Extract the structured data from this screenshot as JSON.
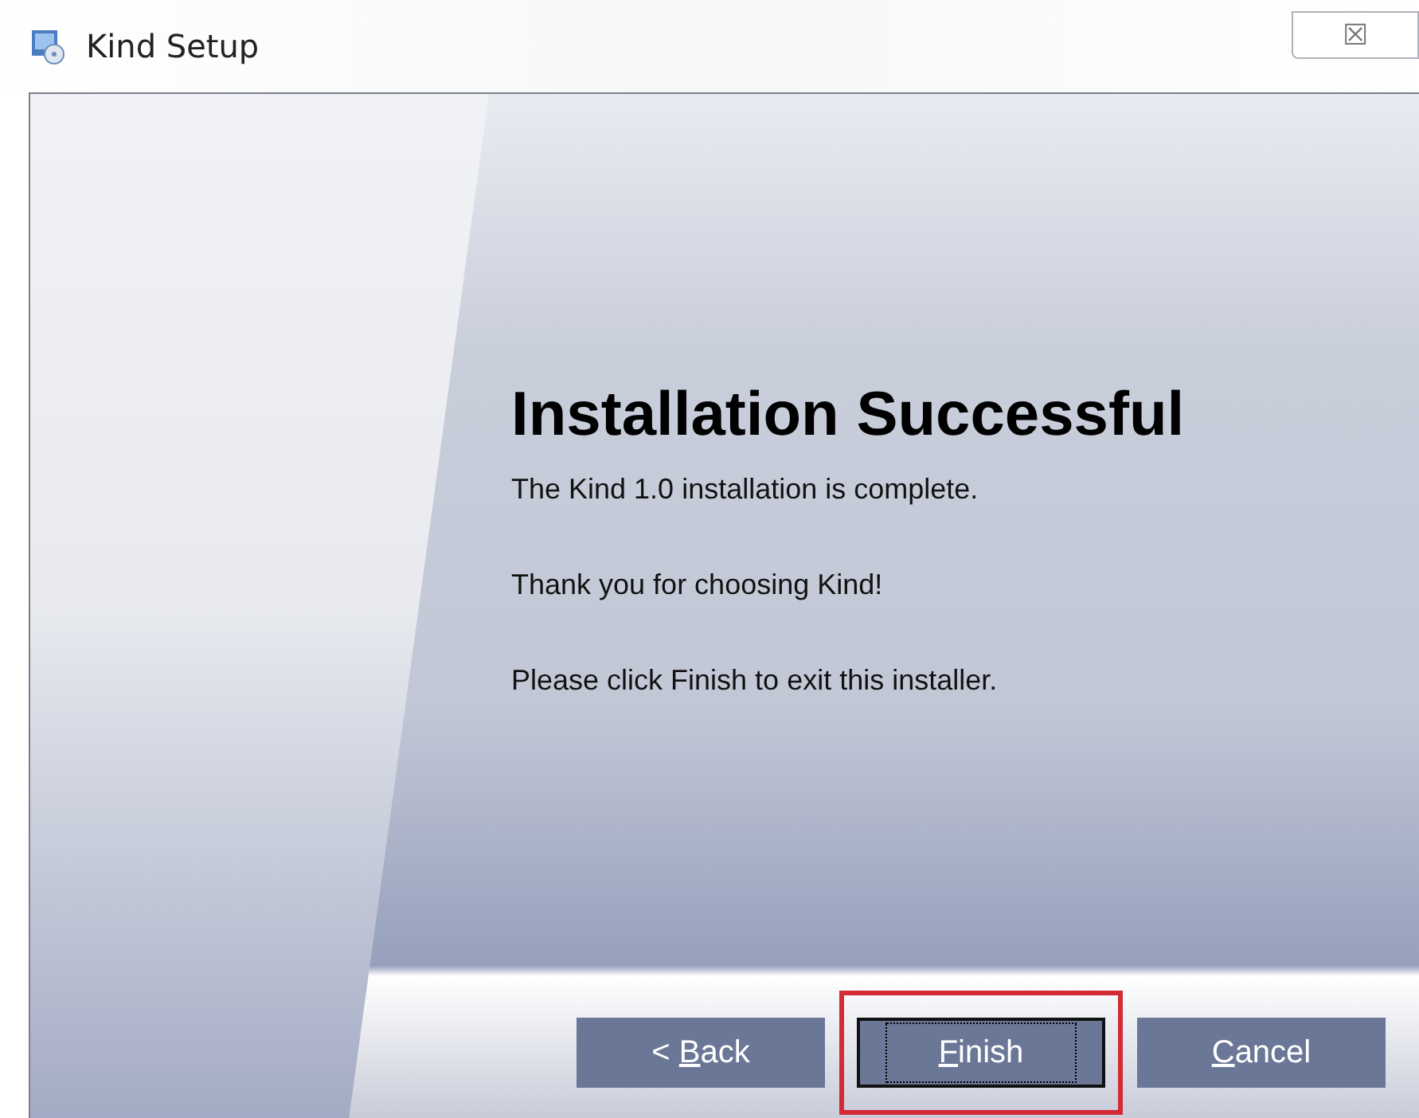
{
  "window": {
    "title": "Kind Setup",
    "close_symbol": "☒"
  },
  "content": {
    "heading": "Installation Successful",
    "paragraphs": [
      "The Kind 1.0 installation is complete.",
      "Thank you for choosing Kind!",
      "Please click Finish to exit this installer."
    ]
  },
  "buttons": [
    {
      "before_key": "< ",
      "access_key": "B",
      "after_key": "ack",
      "default": false,
      "highlighted": false
    },
    {
      "access_key": "F",
      "after_key": "inish",
      "default": true,
      "highlighted": true
    },
    {
      "access_key": "C",
      "after_key": "ancel",
      "default": false,
      "highlighted": false
    }
  ]
}
